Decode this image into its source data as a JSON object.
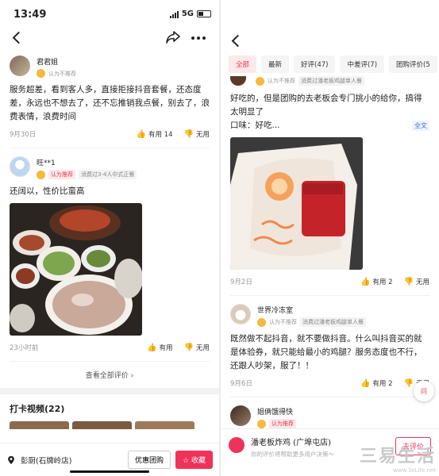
{
  "left": {
    "status": {
      "time": "13:49",
      "network": "5G"
    },
    "reviews": [
      {
        "user": "君君姐",
        "badge": "认为不推荐",
        "consumption": "",
        "text": "服务超差，看到客人多，直接拒接抖音套餐，还态度差，永远也不想去了，还不忘推销我点餐，别去了，浪费表情，浪费时间",
        "date": "9月30日",
        "like": "有用 14",
        "dislike": "无用"
      },
      {
        "user": "旺**1",
        "badge": "认为推荐",
        "consumption": "消费过3-4人中式正餐",
        "text": "还阔以，性价比蛮高",
        "date": "23小时前",
        "like": "有用",
        "dislike": "无用"
      }
    ],
    "see_all": "查看全部评价",
    "videos_title": "打卡视频(22)",
    "location": "彭厨(石牌岭店)",
    "coupon_button": "优惠团购",
    "fav_button": "收藏"
  },
  "right": {
    "filters": [
      "全部",
      "最新",
      "好评(47)",
      "中差评(7)",
      "团购评价(5"
    ],
    "reviews": [
      {
        "user": "",
        "badge": "认为不推荐",
        "consumption": "消费过潘老板鸡腿单人餐",
        "text": "好吃的，但是团购的去老板会专门挑小的给你，搞得太明显了",
        "extra": "口味：好吃...",
        "fulltext": "全文",
        "date": "9月2日",
        "like": "有用 2",
        "dislike": "无用"
      },
      {
        "user": "世界冷冻室",
        "badge": "认为不推荐",
        "consumption": "消费过潘老板鸡腿单人餐",
        "text": "既然做不起抖音，就不要做抖音。什么叫抖音买的就是体验券，就只能给最小的鸡腿？服务态度也不行，还跟人吵架，服了！！",
        "date": "9月6日",
        "like": "有用 2",
        "dislike": "无用"
      },
      {
        "user": "姐俩饿得快",
        "badge": "认为推荐",
        "consumption": "",
        "text": ""
      }
    ],
    "float_label": "问",
    "shop_name": "潘老板炸鸡 (广埠屯店)",
    "shop_sub": "你的评价将帮助更多用户决策～",
    "write_button": "去评价"
  },
  "watermark": {
    "main": "三易生活",
    "sub": "www.3eLife.net"
  },
  "colors": {
    "accent": "#f0325b",
    "tag_red": "#e63a4c",
    "link_blue": "#3b6fd8"
  },
  "icons": [
    "back-icon",
    "share-icon",
    "more-icon",
    "face-icon",
    "thumb-up-icon",
    "thumb-down-icon",
    "location-pin-icon",
    "star-icon"
  ]
}
